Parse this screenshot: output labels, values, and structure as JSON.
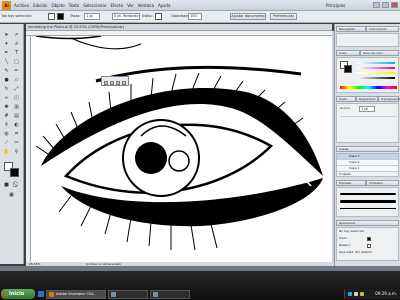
{
  "app": {
    "logo_text": "Ai",
    "workspace": "Principios"
  },
  "menu": [
    "Archivo",
    "Edición",
    "Objeto",
    "Texto",
    "Seleccionar",
    "Efecto",
    "Ver",
    "Ventana",
    "Ayuda"
  ],
  "control_bar": {
    "selection_status": "No hay selección",
    "stroke_label": "Trazo:",
    "stroke_value": "1 pt",
    "profile_value": "5 pt. Redondo",
    "style_label": "Estilo:",
    "opacity_label": "Opacidad:",
    "opacity_value": "100",
    "doc_setup_button": "Ajustar documento",
    "preferences_button": "Preferencias"
  },
  "document": {
    "tab_title": "recreating the Photo.ai @ 25.53% (CMYK/Previsualizar)",
    "status_zoom": "25.53%",
    "status_info": "Archivo no almacenado"
  },
  "panels": {
    "top_tabs": [
      "Navegador",
      "Información"
    ],
    "color_tab": "Color",
    "color_guide_tab": "Guía de color",
    "appearance_tabs": [
      "Apariencia",
      "Estilos gráficos"
    ],
    "stroke_tabs": [
      "Trazo",
      "Degradado",
      "Transparencia"
    ],
    "stroke_weight_label": "Grosor:",
    "stroke_weight_value": "1 pt",
    "layers_tab": "Capas",
    "layers": [
      {
        "name": "Capa 3",
        "selected": true
      },
      {
        "name": "Capa 2",
        "selected": false
      },
      {
        "name": "Capa 1",
        "selected": false
      }
    ],
    "layers_count": "3 capas",
    "brushes_tab": "Pinceles",
    "symbols_tab": "Símbolos",
    "appearance_title": "Apariencia",
    "appearance_rows": [
      "No hay selección",
      "Trazo:",
      "Relleno:",
      "Opacidad:  Por defecto"
    ]
  },
  "taskbar": {
    "start_label": "Inicio",
    "tasks": [
      {
        "label": "Adobe Illustrator CS4...",
        "active": true
      },
      {
        "label": "",
        "active": false
      },
      {
        "label": "",
        "active": false
      }
    ],
    "clock": "09:29 a.m."
  }
}
